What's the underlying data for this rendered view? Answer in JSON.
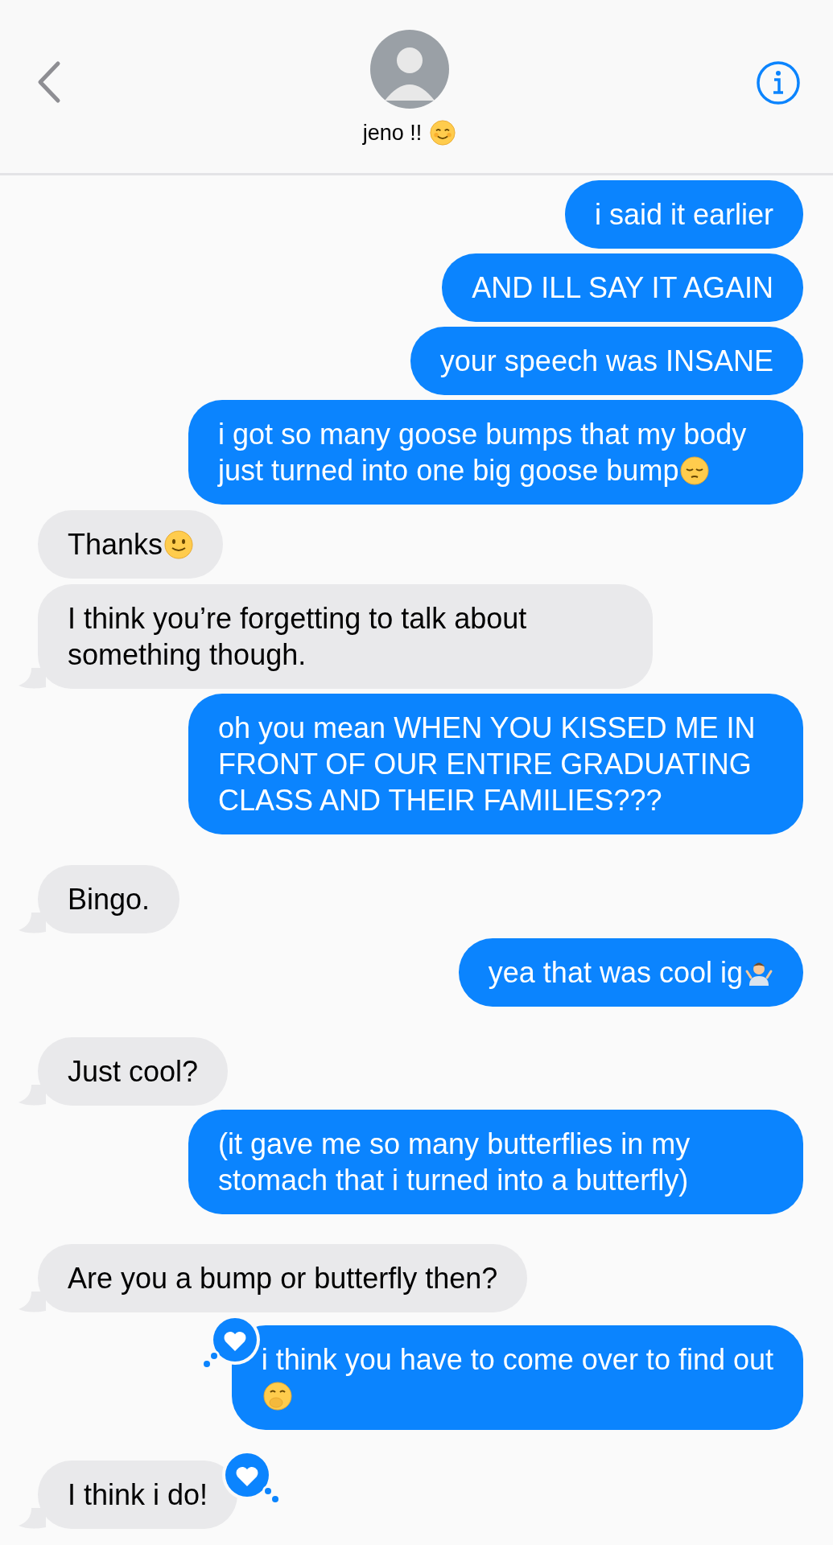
{
  "header": {
    "contact_name": "jeno !!"
  },
  "messages": [
    {
      "outgoing": true,
      "text": "i said it earlier"
    },
    {
      "outgoing": true,
      "text": "AND ILL SAY IT AGAIN"
    },
    {
      "outgoing": true,
      "text": "your speech was INSANE"
    },
    {
      "outgoing": true,
      "text": "i got so many goose bumps that my body just turned into one big goose bump"
    },
    {
      "outgoing": false,
      "text": "Thanks"
    },
    {
      "outgoing": false,
      "text": "I think you’re forgetting to talk about something though."
    },
    {
      "outgoing": true,
      "text": "oh you mean WHEN YOU KISSED ME IN FRONT OF OUR ENTIRE GRADUATING CLASS AND THEIR FAMILIES???"
    },
    {
      "outgoing": false,
      "text": "Bingo."
    },
    {
      "outgoing": true,
      "text": "yea that was cool ig"
    },
    {
      "outgoing": false,
      "text": "Just cool?"
    },
    {
      "outgoing": true,
      "text": "(it gave me so many butterflies in my stomach that i turned into a butterfly)"
    },
    {
      "outgoing": false,
      "text": "Are you a bump or butterfly then?"
    },
    {
      "outgoing": true,
      "text": "i think you have to come over to find out",
      "hearted": true
    },
    {
      "outgoing": false,
      "text": "I think i do!",
      "hearted": true
    }
  ]
}
